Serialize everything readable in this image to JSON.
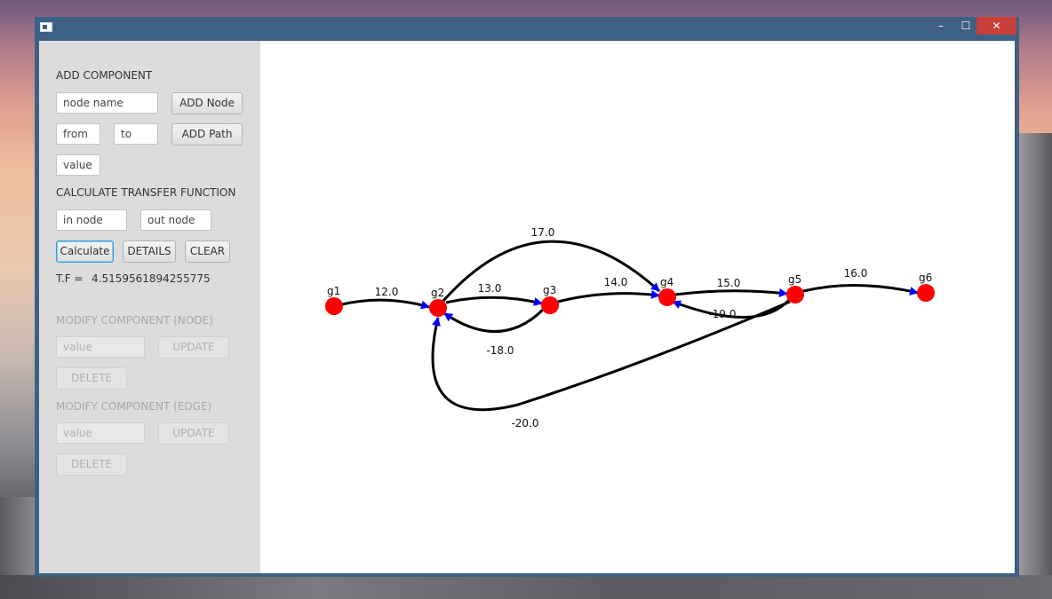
{
  "window": {
    "controls": {
      "minimize": "–",
      "maximize": "☐",
      "close": "✕"
    }
  },
  "add_component": {
    "heading": "ADD COMPONENT",
    "node_name_placeholder": "node name",
    "add_node_label": "ADD Node",
    "from_placeholder": "from",
    "to_placeholder": "to",
    "add_path_label": "ADD Path",
    "value_placeholder": "value"
  },
  "transfer_function": {
    "heading": "CALCULATE TRANSFER FUNCTION",
    "in_node_placeholder": "in node",
    "out_node_placeholder": "out node",
    "calculate_label": "Calculate",
    "details_label": "DETAILS",
    "clear_label": "CLEAR",
    "result_label": "T.F =",
    "result_value": "4.5159561894255775"
  },
  "modify_node": {
    "heading": "MODIFY COMPONENT (NODE)",
    "value_placeholder": "value",
    "update_label": "UPDATE",
    "delete_label": "DELETE"
  },
  "modify_edge": {
    "heading": "MODIFY COMPONENT (EDGE)",
    "value_placeholder": "value",
    "update_label": "UPDATE",
    "delete_label": "DELETE"
  },
  "graph": {
    "node_color": "#ff0000",
    "arrow_color": "#0000ff",
    "nodes": [
      {
        "id": "g1"
      },
      {
        "id": "g2"
      },
      {
        "id": "g3"
      },
      {
        "id": "g4"
      },
      {
        "id": "g5"
      },
      {
        "id": "g6"
      }
    ],
    "edges": [
      {
        "from": "g1",
        "to": "g2",
        "value": "12.0"
      },
      {
        "from": "g2",
        "to": "g3",
        "value": "13.0"
      },
      {
        "from": "g2",
        "to": "g4",
        "value": "17.0"
      },
      {
        "from": "g3",
        "to": "g2",
        "value": "-18.0"
      },
      {
        "from": "g3",
        "to": "g4",
        "value": "14.0"
      },
      {
        "from": "g4",
        "to": "g5",
        "value": "15.0"
      },
      {
        "from": "g5",
        "to": "g4",
        "value": "-19.0"
      },
      {
        "from": "g5",
        "to": "g2",
        "value": "-20.0"
      },
      {
        "from": "g5",
        "to": "g6",
        "value": "16.0"
      }
    ]
  }
}
